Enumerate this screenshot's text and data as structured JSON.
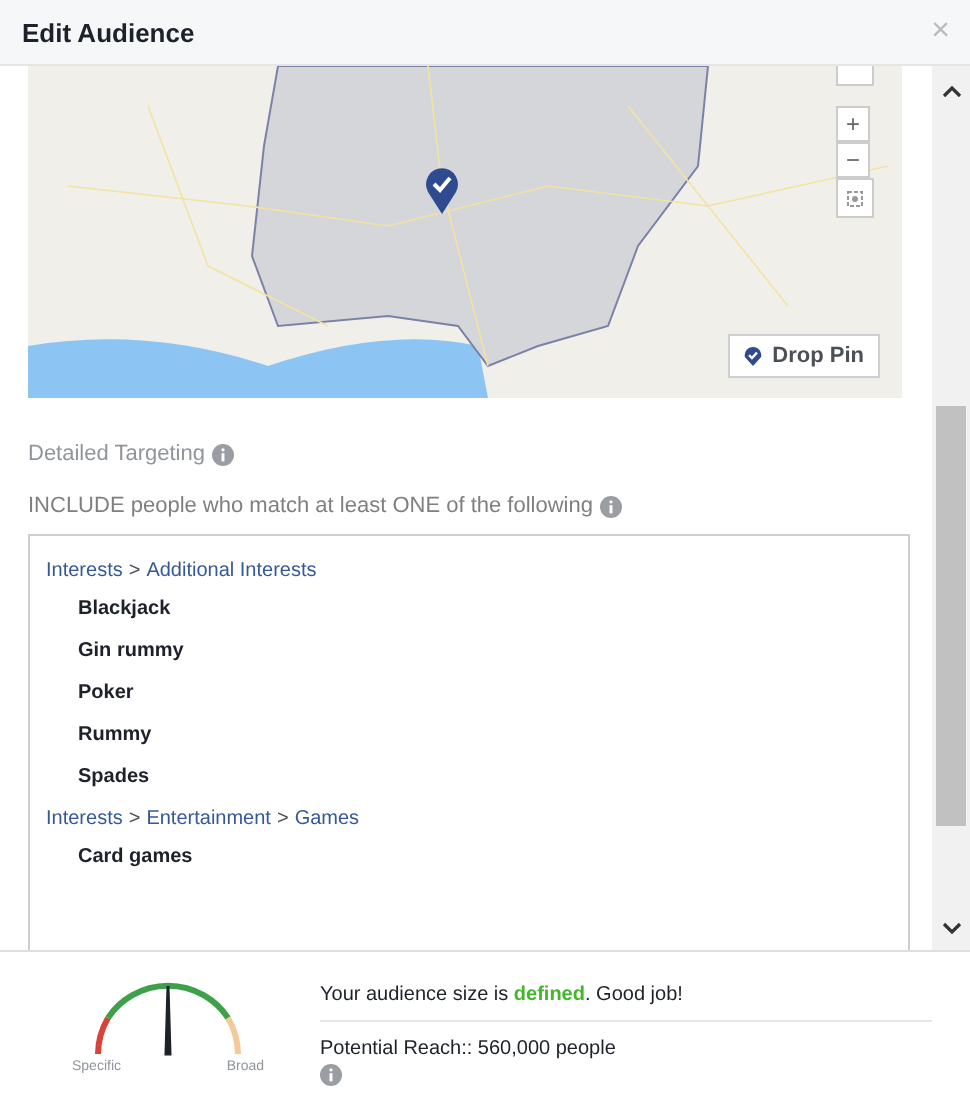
{
  "window": {
    "title": "Edit Audience",
    "close": "×"
  },
  "map": {
    "zoom_controls": [
      "+",
      "−"
    ],
    "drop_pin": "Drop Pin"
  },
  "detailed_targeting": {
    "label": "Detailed Targeting",
    "include_label": "INCLUDE people who match at least ONE of the following",
    "groups": [
      {
        "path": [
          "Interests",
          "Additional Interests"
        ],
        "separator": ">",
        "items": [
          "Blackjack",
          "Gin rummy",
          "Poker",
          "Rummy",
          "Spades"
        ]
      },
      {
        "path": [
          "Interests",
          "Entertainment",
          "Games"
        ],
        "separator": ">",
        "items": [
          "Card games"
        ]
      }
    ]
  },
  "audience": {
    "gauge": {
      "level": 0.5,
      "left_label": "Specific",
      "right_label": "Broad"
    },
    "status": "Your audience size is **defined**. Good job!",
    "reach": "Potential Reach:: 560,000 people"
  }
}
